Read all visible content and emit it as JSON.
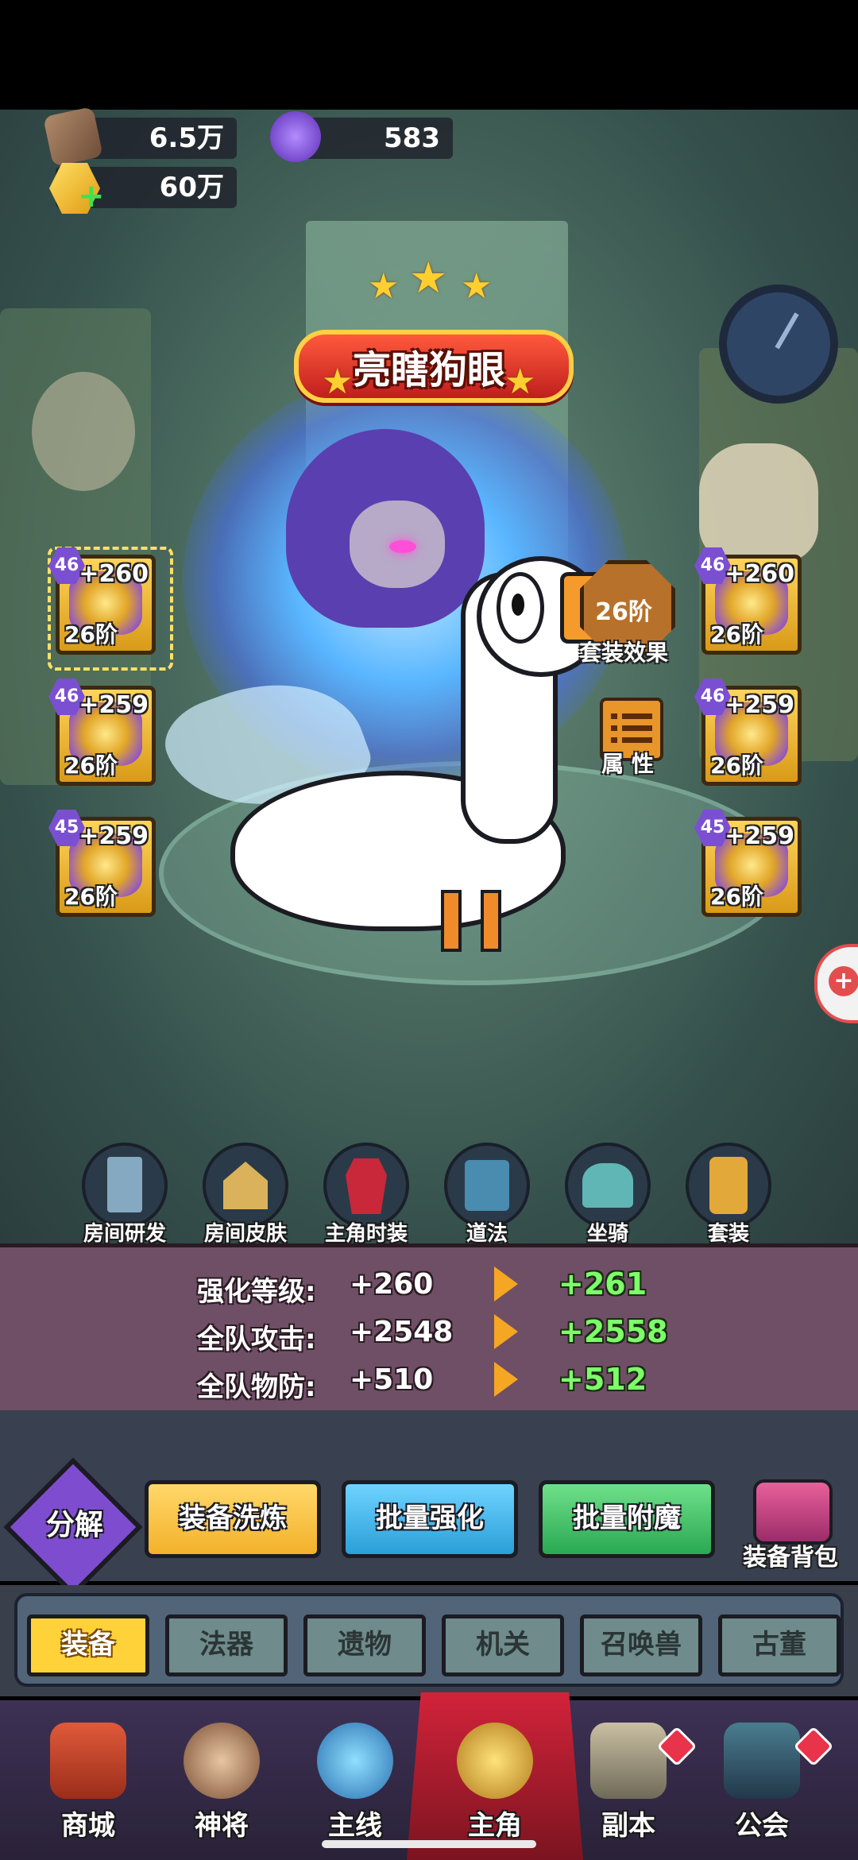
{
  "resources": {
    "wood": {
      "icon": "wood-plank-icon",
      "value": "6.5万"
    },
    "crystal": {
      "icon": "purple-demon-crystal-icon",
      "value": "583"
    },
    "gold": {
      "icon": "gold-cube-plus-icon",
      "value": "60万"
    }
  },
  "character": {
    "title": "亮瞎狗眼"
  },
  "equipment_left": [
    {
      "level": "46",
      "plus": "+260",
      "tier": "26阶",
      "selected": true
    },
    {
      "level": "46",
      "plus": "+259",
      "tier": "26阶",
      "selected": false
    },
    {
      "level": "45",
      "plus": "+259",
      "tier": "26阶",
      "selected": false
    }
  ],
  "equipment_right": [
    {
      "level": "46",
      "plus": "+260",
      "tier": "26阶"
    },
    {
      "level": "46",
      "plus": "+259",
      "tier": "26阶"
    },
    {
      "level": "45",
      "plus": "+259",
      "tier": "26阶"
    }
  ],
  "side_buttons": {
    "set_effect": {
      "badge": "26阶",
      "label": "套装效果"
    },
    "attributes": {
      "label": "属 性"
    }
  },
  "functions": [
    {
      "label": "房间研发",
      "icon": "room-research-icon"
    },
    {
      "label": "房间皮肤",
      "icon": "room-skin-icon"
    },
    {
      "label": "主角时装",
      "icon": "costume-icon"
    },
    {
      "label": "道法",
      "icon": "spellbook-icon"
    },
    {
      "label": "坐骑",
      "icon": "mount-icon"
    },
    {
      "label": "套装",
      "icon": "set-scroll-icon"
    }
  ],
  "stats": [
    {
      "label": "强化等级:",
      "current": "+260",
      "next": "+261"
    },
    {
      "label": "全队攻击:",
      "current": "+2548",
      "next": "+2558"
    },
    {
      "label": "全队物防:",
      "current": "+510",
      "next": "+512"
    }
  ],
  "actions": {
    "decompose": "分解",
    "refine": "装备洗炼",
    "batch_enhance": "批量强化",
    "batch_enchant": "批量附魔",
    "backpack": "装备背包"
  },
  "tabs": [
    "装备",
    "法器",
    "遗物",
    "机关",
    "召唤兽",
    "古董"
  ],
  "active_tab": "装备",
  "nav": [
    {
      "label": "商城",
      "icon": "shop-icon",
      "badge": false
    },
    {
      "label": "神将",
      "icon": "hero-icon",
      "badge": false
    },
    {
      "label": "主线",
      "icon": "crossed-swords-icon",
      "badge": false
    },
    {
      "label": "主角",
      "icon": "protagonist-icon",
      "badge": false,
      "active": true
    },
    {
      "label": "副本",
      "icon": "dungeon-icon",
      "badge": true
    },
    {
      "label": "公会",
      "icon": "guild-icon",
      "badge": true
    }
  ],
  "colors": {
    "accent_gold": "#ffd23a",
    "stat_increase": "#7dff6a",
    "nav_active": "#d2233a",
    "decompose_purple": "#7e4dcf",
    "refine_yellow": "#ffcb45",
    "enhance_blue": "#3fb6e8",
    "enchant_green": "#3cc46a"
  }
}
